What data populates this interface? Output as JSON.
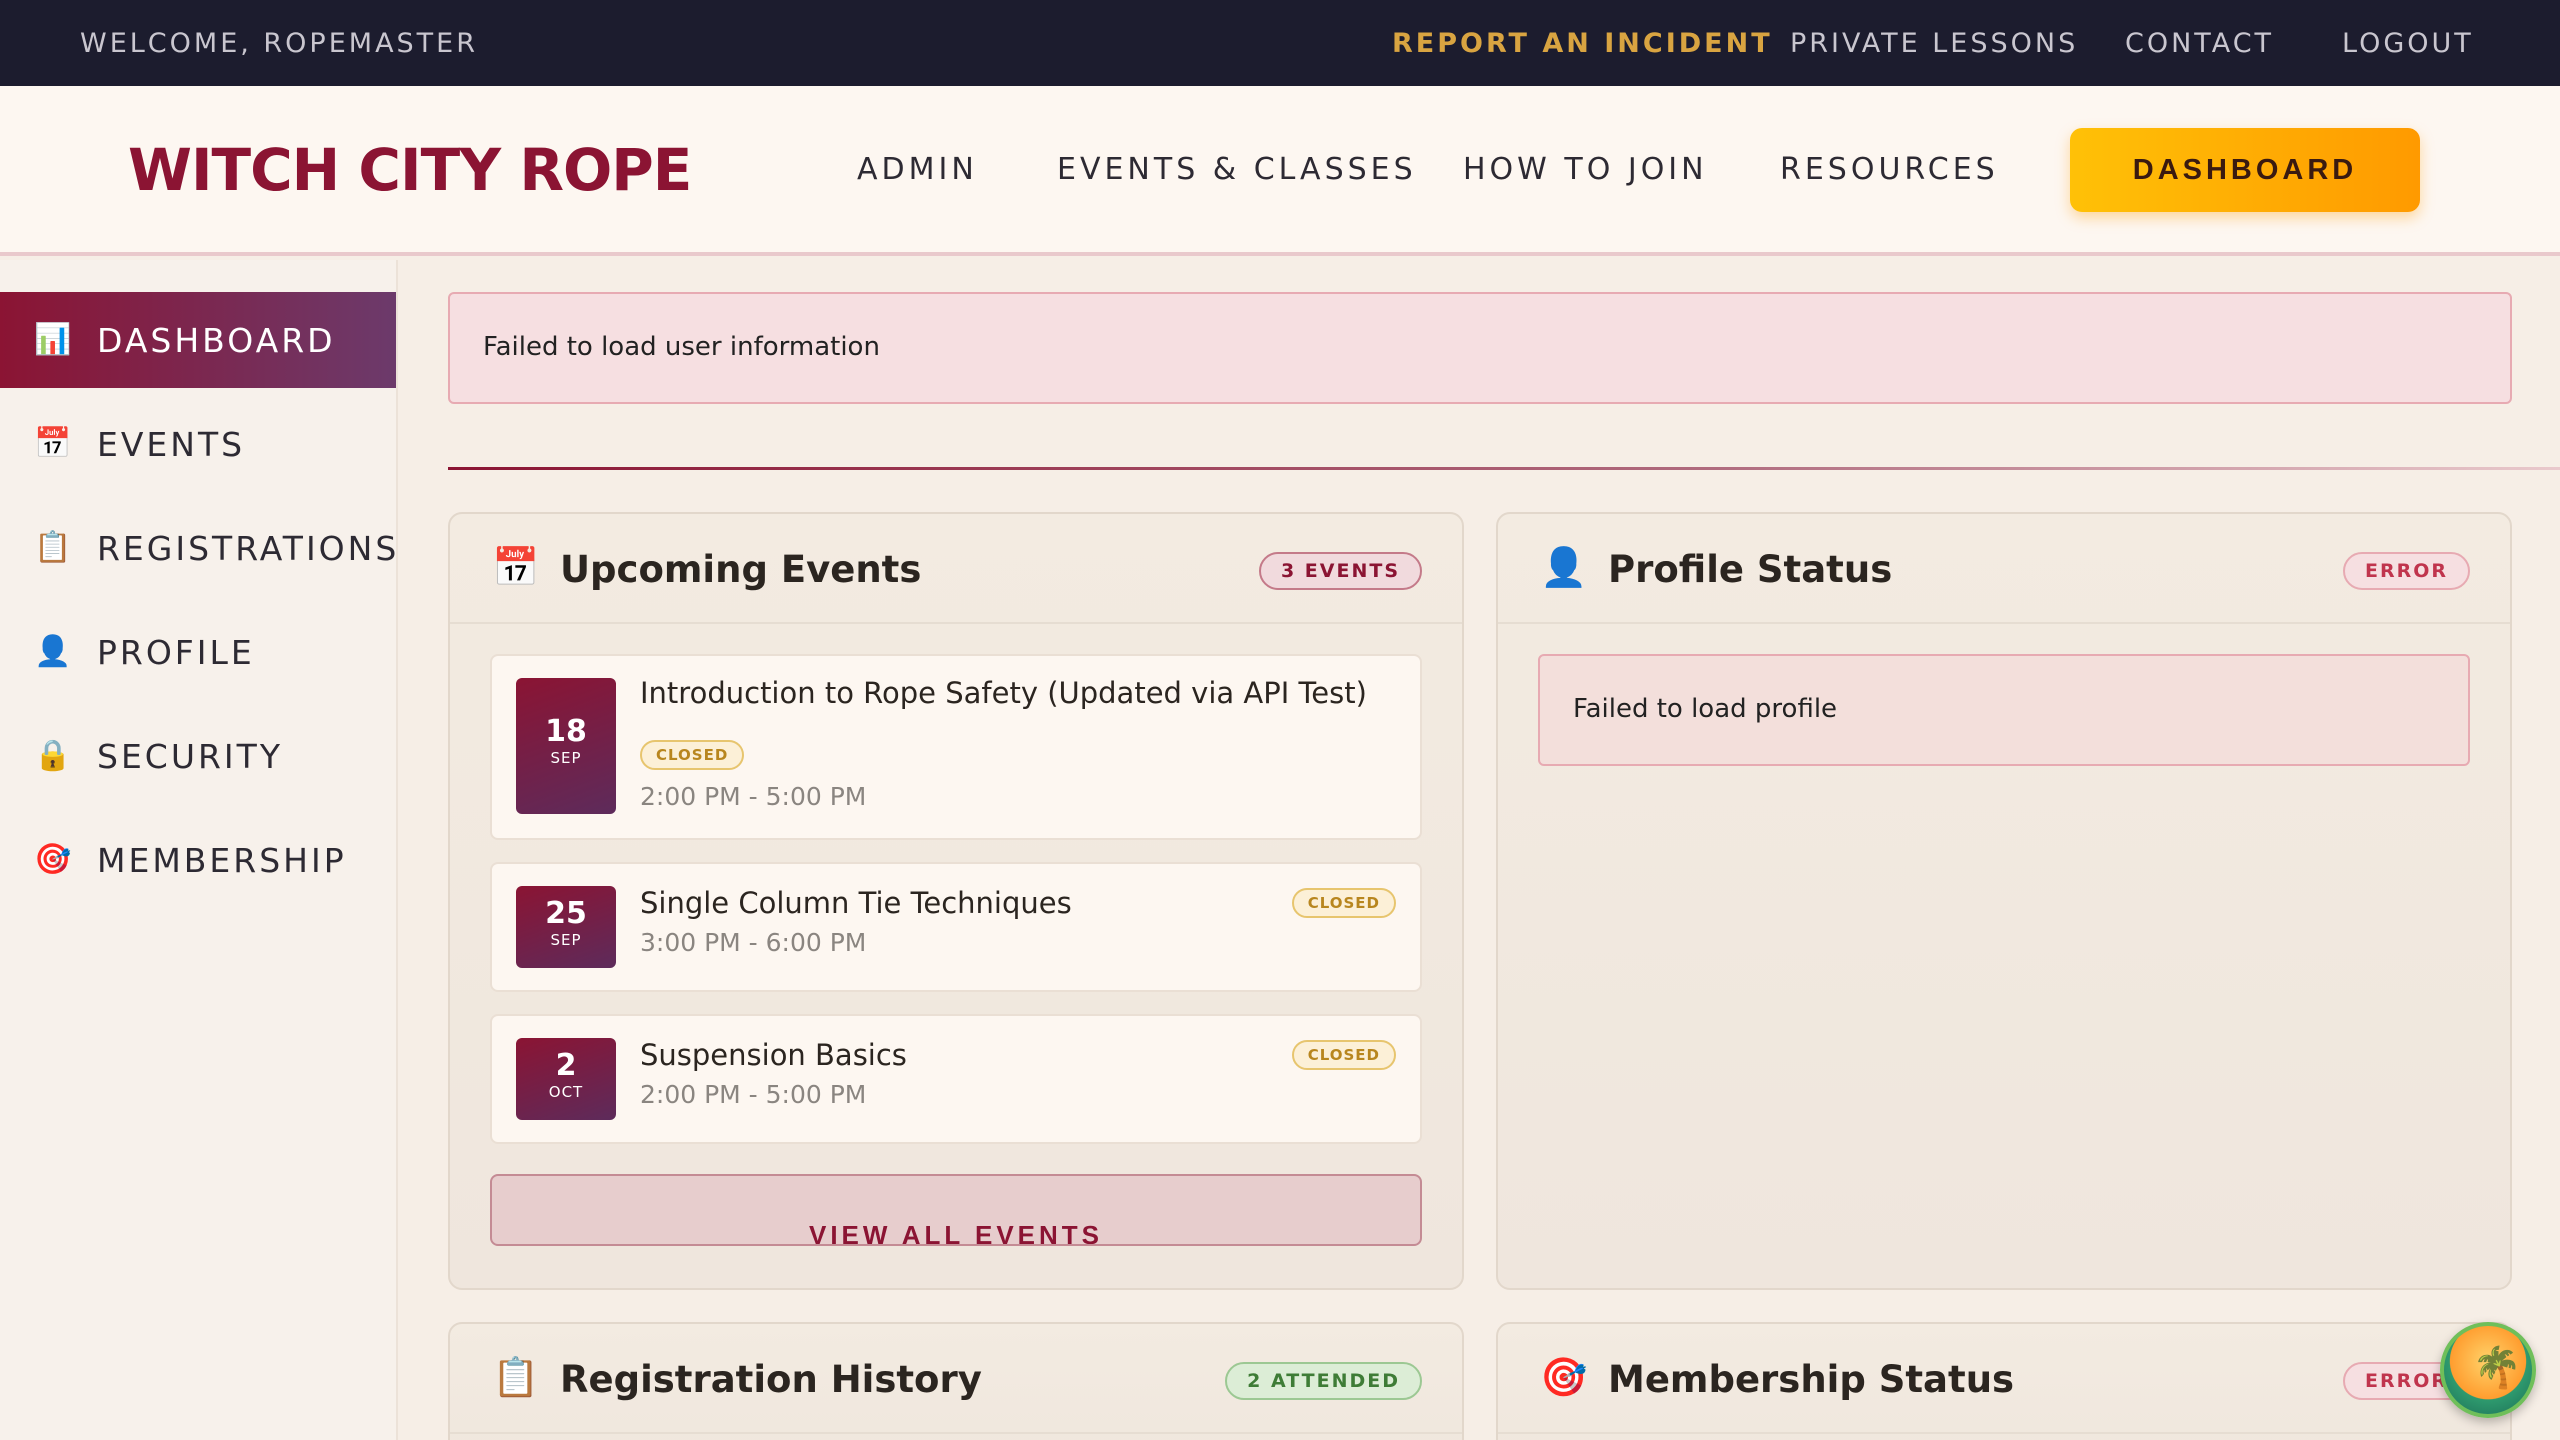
{
  "utility": {
    "welcome": "WELCOME, ROPEMASTER",
    "links": [
      "REPORT AN INCIDENT",
      "PRIVATE LESSONS",
      "CONTACT",
      "LOGOUT"
    ]
  },
  "header": {
    "brand": "WITCH CITY ROPE",
    "nav": [
      "ADMIN",
      "EVENTS & CLASSES",
      "HOW TO JOIN",
      "RESOURCES"
    ],
    "cta": "DASHBOARD"
  },
  "sidebar": {
    "items": [
      {
        "label": "DASHBOARD",
        "icon": "📊",
        "active": true
      },
      {
        "label": "EVENTS",
        "icon": "📅"
      },
      {
        "label": "REGISTRATIONS",
        "icon": "📋"
      },
      {
        "label": "PROFILE",
        "icon": "👤"
      },
      {
        "label": "SECURITY",
        "icon": "🔒"
      },
      {
        "label": "MEMBERSHIP",
        "icon": "🎯"
      }
    ]
  },
  "alert": {
    "message": "Failed to load user information"
  },
  "upcoming": {
    "title": "Upcoming Events",
    "icon": "📅",
    "badge": "3 EVENTS",
    "events": [
      {
        "day": "18",
        "month": "SEP",
        "title": "Introduction to Rope Safety (Updated via API Test)",
        "status": "CLOSED",
        "time": "2:00 PM - 5:00 PM"
      },
      {
        "day": "25",
        "month": "SEP",
        "title": "Single Column Tie Techniques",
        "status": "CLOSED",
        "time": "3:00 PM - 6:00 PM"
      },
      {
        "day": "2",
        "month": "OCT",
        "title": "Suspension Basics",
        "status": "CLOSED",
        "time": "2:00 PM - 5:00 PM"
      }
    ],
    "view_all": "VIEW ALL EVENTS"
  },
  "profile": {
    "title": "Profile Status",
    "icon": "👤",
    "badge": "ERROR",
    "error": "Failed to load profile"
  },
  "registration": {
    "title": "Registration History",
    "icon": "📋",
    "badge": "2 ATTENDED"
  },
  "membership": {
    "title": "Membership Status",
    "icon": "🎯",
    "badge": "ERROR"
  },
  "fab": {
    "icon": "🌴"
  },
  "colors": {
    "brand": "#8b1433",
    "utility_bg": "#1c1c2e",
    "incident": "#d9a441",
    "cta_start": "#ffc107",
    "cta_end": "#ff9a00"
  }
}
